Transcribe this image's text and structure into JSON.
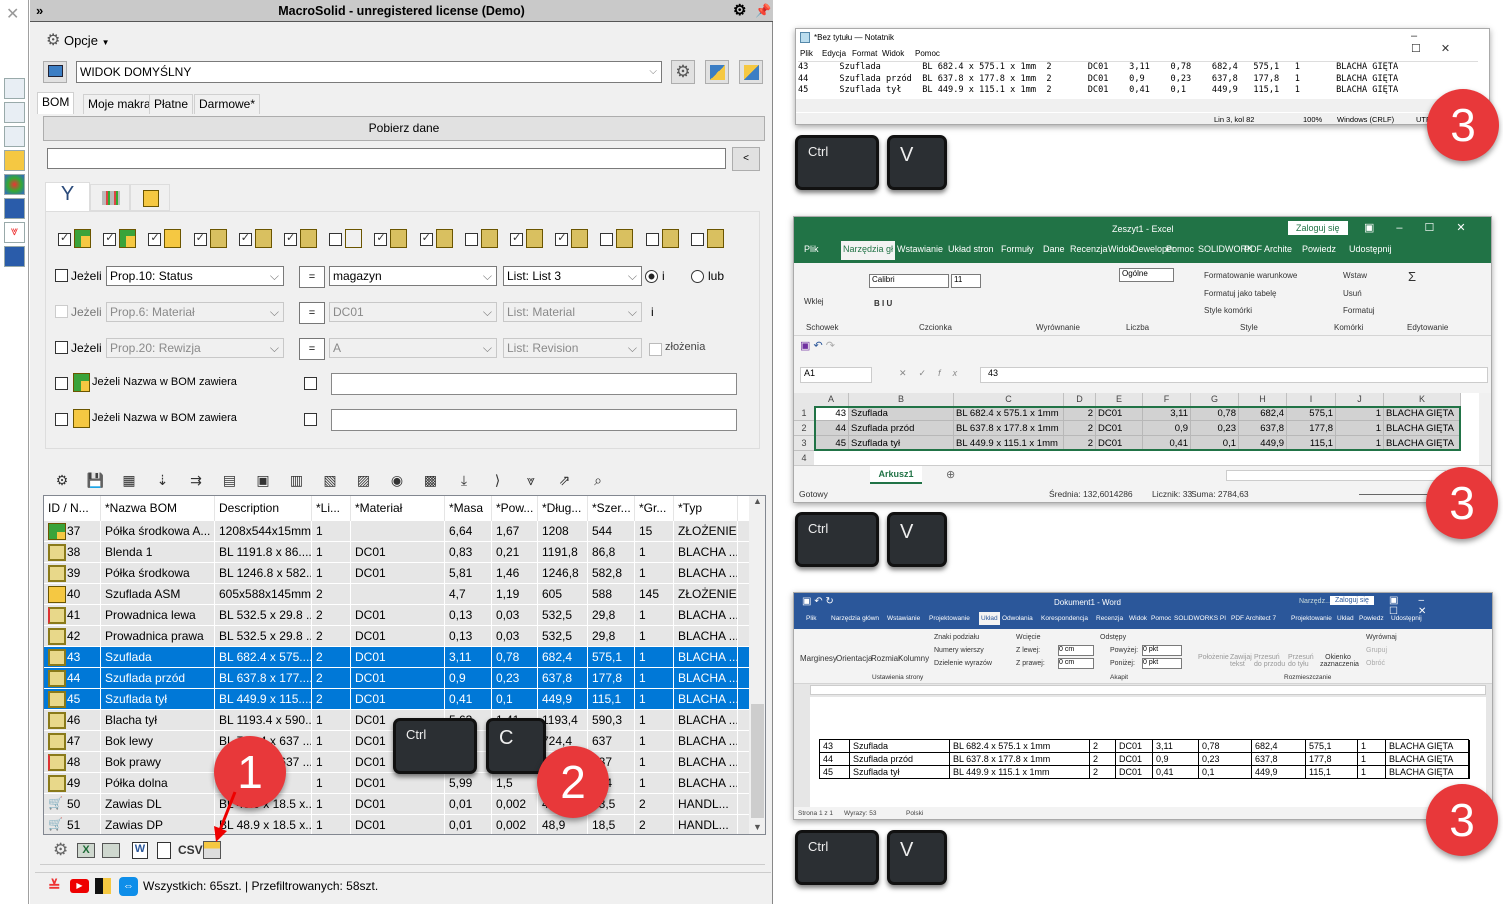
{
  "app": {
    "title": "MacroSolid - unregistered license (Demo)",
    "options_label": "Opcje"
  },
  "view": {
    "selected": "WIDOK DOMYŚLNY"
  },
  "tabs": [
    "BOM",
    "Moje makra",
    "Płatne",
    "Darmowe*"
  ],
  "fetch_button": "Pobierz dane",
  "search": {
    "value": "",
    "collapse_label": "<"
  },
  "filter_icons_checked": [
    true,
    true,
    true,
    true,
    true,
    true,
    false,
    true,
    true,
    false,
    true,
    true,
    false,
    false,
    false
  ],
  "conditions": [
    {
      "checked": false,
      "label": "Jeżeli",
      "property": "Prop.10: Status",
      "op": "=",
      "value": "magazyn",
      "list": "List: List 3",
      "enabled": true
    },
    {
      "checked": false,
      "label": "Jeżeli",
      "property": "Prop.6: Materiał",
      "op": "=",
      "value": "DC01",
      "list": "List: Material",
      "enabled": false
    },
    {
      "checked": false,
      "label": "Jeżeli",
      "property": "Prop.20: Rewizja",
      "op": "=",
      "value": "A",
      "list": "List: Revision",
      "enabled": false
    }
  ],
  "logic": {
    "and_label": "i",
    "or_label": "lub",
    "selected": "i",
    "row2_suffix": "i",
    "assemblies_label": "złożenia"
  },
  "name_filters": [
    {
      "label": "Jeżeli Nazwa w BOM zawiera",
      "value": ""
    },
    {
      "label": "Jeżeli Nazwa w BOM zawiera",
      "value": ""
    }
  ],
  "table": {
    "columns": [
      "ID / N...",
      "*Nazwa BOM",
      "Description",
      "*Li...",
      "*Materiał",
      "*Masa",
      "*Pow...",
      "*Dług...",
      "*Szer...",
      "*Gr...",
      "*Typ"
    ],
    "rows": [
      {
        "icon": "assembly",
        "cells": [
          "37",
          "Półka środkowa A...",
          "1208x544x15mm",
          "1",
          "",
          "6,64",
          "1,67",
          "1208",
          "544",
          "15",
          "ZŁOŻENIE"
        ]
      },
      {
        "icon": "sheet-metal",
        "cells": [
          "38",
          "Blenda 1",
          "BL 1191.8 x 86....",
          "1",
          "DC01",
          "0,83",
          "0,21",
          "1191,8",
          "86,8",
          "1",
          "BLACHA ..."
        ]
      },
      {
        "icon": "sheet-metal",
        "cells": [
          "39",
          "Półka środkowa",
          "BL 1246.8 x 582...",
          "1",
          "DC01",
          "5,81",
          "1,46",
          "1246,8",
          "582,8",
          "1",
          "BLACHA ..."
        ]
      },
      {
        "icon": "assembly-empty",
        "cells": [
          "40",
          "Szuflada ASM",
          "605x588x145mm",
          "2",
          "",
          "4,7",
          "1,19",
          "605",
          "588",
          "145",
          "ZŁOŻENIE"
        ]
      },
      {
        "icon": "sheet-metal-mirror",
        "cells": [
          "41",
          "Prowadnica lewa",
          "BL 532.5 x 29.8 ...",
          "2",
          "DC01",
          "0,13",
          "0,03",
          "532,5",
          "29,8",
          "1",
          "BLACHA ..."
        ]
      },
      {
        "icon": "sheet-metal",
        "cells": [
          "42",
          "Prowadnica prawa",
          "BL 532.5 x 29.8 ...",
          "2",
          "DC01",
          "0,13",
          "0,03",
          "532,5",
          "29,8",
          "1",
          "BLACHA ..."
        ]
      },
      {
        "icon": "sheet-metal",
        "selected": true,
        "cells": [
          "43",
          "Szuflada",
          "BL 682.4 x 575....",
          "2",
          "DC01",
          "3,11",
          "0,78",
          "682,4",
          "575,1",
          "1",
          "BLACHA ..."
        ]
      },
      {
        "icon": "sheet-metal",
        "selected": true,
        "cells": [
          "44",
          "Szuflada przód",
          "BL 637.8 x 177....",
          "2",
          "DC01",
          "0,9",
          "0,23",
          "637,8",
          "177,8",
          "1",
          "BLACHA ..."
        ]
      },
      {
        "icon": "sheet-metal",
        "selected": true,
        "cells": [
          "45",
          "Szuflada tył",
          "BL 449.9 x 115....",
          "2",
          "DC01",
          "0,41",
          "0,1",
          "449,9",
          "115,1",
          "1",
          "BLACHA ..."
        ]
      },
      {
        "icon": "sheet-metal",
        "cells": [
          "46",
          "Blacha tył",
          "BL 1193.4 x 590...",
          "1",
          "DC01",
          "5,63",
          "1,41",
          "1193,4",
          "590,3",
          "1",
          "BLACHA ..."
        ]
      },
      {
        "icon": "sheet-metal",
        "cells": [
          "47",
          "Bok lewy",
          "BL 724.4 x 637 ...",
          "1",
          "DC01",
          "",
          "",
          "724,4",
          "637",
          "1",
          "BLACHA ..."
        ]
      },
      {
        "icon": "sheet-metal-mirror",
        "cells": [
          "48",
          "Bok prawy",
          "BL 724.4 x 637 ...",
          "1",
          "DC01",
          "",
          "",
          "724,4",
          "637",
          "1",
          "BLACHA ..."
        ]
      },
      {
        "icon": "sheet-metal",
        "cells": [
          "49",
          "Półka dolna",
          "BL 1191.4...",
          "1",
          "DC01",
          "5,99",
          "1,5",
          "",
          "...,4",
          "1",
          "BLACHA ..."
        ]
      },
      {
        "icon": "purchased",
        "cells": [
          "50",
          "Zawias DL",
          "BL 48.9 x 18.5 x...",
          "1",
          "DC01",
          "0,01",
          "0,002",
          "48,9",
          "18,5",
          "2",
          "HANDL..."
        ]
      },
      {
        "icon": "purchased",
        "cells": [
          "51",
          "Zawias DP",
          "BL 48.9 x 18.5 x...",
          "1",
          "DC01",
          "0,01",
          "0,002",
          "48,9",
          "18,5",
          "2",
          "HANDL..."
        ]
      }
    ]
  },
  "export_bar": {
    "csv_label": "CSV"
  },
  "status": {
    "text": "Wszystkich: 65szt. | Przefiltrowanych: 58szt."
  },
  "overlay": {
    "keys": {
      "ctrl": "Ctrl",
      "c": "C",
      "v": "V"
    },
    "steps": [
      "1",
      "2",
      "3"
    ]
  },
  "notepad": {
    "title": "*Bez tytułu — Notatnik",
    "menu": [
      "Plik",
      "Edycja",
      "Format",
      "Widok",
      "Pomoc"
    ],
    "lines": [
      "43\tSzuflada\tBL 682.4 x 575.1 x 1mm  2\tDC01\t3,11\t0,78\t682,4\t575,1\t1\tBLACHA GIĘTA",
      "44\tSzuflada przód\tBL 637.8 x 177.8 x 1mm  2\tDC01\t0,9\t0,23\t637,8\t177,8\t1\tBLACHA GIĘTA",
      "45\tSzuflada tył\tBL 449.9 x 115.1 x 1mm  2\tDC01\t0,41\t0,1\t449,9\t115,1\t1\tBLACHA GIĘTA"
    ],
    "status": {
      "position": "Lin 3, kol 82",
      "zoom": "100%",
      "eol": "Windows (CRLF)",
      "encoding": "UTF-8"
    }
  },
  "excel": {
    "title": "Zeszyt1 - Excel",
    "signin": "Zaloguj się",
    "tabs": [
      "Plik",
      "Narzędzia gł",
      "Wstawianie",
      "Układ stron",
      "Formuły",
      "Dane",
      "Recenzja",
      "Widok",
      "Deweloper",
      "Pomoc",
      "SOLIDWORK",
      "PDF Archite",
      "Powiedz",
      "Udostępnij"
    ],
    "groups": [
      "Schowek",
      "Czcionka",
      "Wyrównanie",
      "Liczba",
      "Style",
      "Komórki",
      "Edytowanie"
    ],
    "ribbon": {
      "paste": "Wklej",
      "font": "Calibri",
      "size": "11",
      "number_format": "Ogólne",
      "cond_format": "Formatowanie warunkowe",
      "as_table": "Formatuj jako tabelę",
      "cell_styles": "Style komórki",
      "insert": "Wstaw",
      "delete": "Usuń",
      "format": "Formatuj"
    },
    "name_box": "A1",
    "formula": "43",
    "columns": [
      "A",
      "B",
      "C",
      "D",
      "E",
      "F",
      "G",
      "H",
      "I",
      "J",
      "K"
    ],
    "row_numbers": [
      "1",
      "2",
      "3",
      "4"
    ],
    "rows": [
      [
        "43",
        "Szuflada",
        "BL 682.4 x 575.1 x 1mm",
        "2",
        "DC01",
        "3,11",
        "0,78",
        "682,4",
        "575,1",
        "1",
        "BLACHA GIĘTA"
      ],
      [
        "44",
        "Szuflada przód",
        "BL 637.8 x 177.8 x 1mm",
        "2",
        "DC01",
        "0,9",
        "0,23",
        "637,8",
        "177,8",
        "1",
        "BLACHA GIĘTA"
      ],
      [
        "45",
        "Szuflada tył",
        "BL 449.9 x 115.1 x 1mm",
        "2",
        "DC01",
        "0,41",
        "0,1",
        "449,9",
        "115,1",
        "1",
        "BLACHA GIĘTA"
      ]
    ],
    "sheet": "Arkusz1",
    "status": {
      "ready": "Gotowy",
      "average": "Średnia: 132,6014286",
      "count": "Licznik: 33",
      "sum": "Suma: 2784,63"
    }
  },
  "word": {
    "title": "Dokument1 - Word",
    "context": "Narzędz...",
    "signin": "Zaloguj się",
    "tabs": [
      "Plik",
      "Narzędzia główn",
      "Wstawianie",
      "Projektowanie",
      "Układ",
      "Odwołania",
      "Korespondencja",
      "Recenzja",
      "Widok",
      "Pomoc",
      "SOLIDWORKS PI",
      "PDF Architect 7",
      "Projektowanie",
      "Układ",
      "Powiedz",
      "Udostępnij"
    ],
    "ribbon": {
      "margins": "Marginesy",
      "orientation": "Orientacja",
      "size": "Rozmiar",
      "columns": "Kolumny",
      "breaks": "Znaki podziału",
      "line_numbers": "Numery wierszy",
      "hyphenation": "Dzielenie wyrazów",
      "indent": "Wcięcie",
      "left": "Z lewej:",
      "right": "Z prawej:",
      "left_val": "0 cm",
      "right_val": "0 cm",
      "spacing": "Odstępy",
      "before": "Powyżej:",
      "after": "Poniżej:",
      "before_val": "0 pkt",
      "after_val": "0 pkt",
      "position": "Położenie",
      "wrap": "Zawijaj tekst",
      "forward": "Przesuń do przodu",
      "backward": "Przesuń do tyłu",
      "selection_pane": "Okienko zaznaczenia",
      "align": "Wyrównaj",
      "group": "Grupuj",
      "rotate": "Obróć"
    },
    "groups": [
      "Ustawienia strony",
      "Akapit",
      "Rozmieszczanie"
    ],
    "rows": [
      [
        "43",
        "Szuflada",
        "BL 682.4 x 575.1 x 1mm",
        "2",
        "DC01",
        "3,11",
        "0,78",
        "682,4",
        "575,1",
        "1",
        "BLACHA GIĘTA"
      ],
      [
        "44",
        "Szuflada przód",
        "BL 637.8 x 177.8 x 1mm",
        "2",
        "DC01",
        "0,9",
        "0,23",
        "637,8",
        "177,8",
        "1",
        "BLACHA GIĘTA"
      ],
      [
        "45",
        "Szuflada tył",
        "BL 449.9 x 115.1 x 1mm",
        "2",
        "DC01",
        "0,41",
        "0,1",
        "449,9",
        "115,1",
        "1",
        "BLACHA GIĘTA"
      ]
    ],
    "status": {
      "page": "Strona 1 z 1",
      "words": "Wyrazy: 53",
      "language": "Polski"
    }
  },
  "colors": {
    "selection": "#0078d7",
    "excel": "#217346",
    "word": "#2b579a",
    "badge": "#e8383a"
  }
}
